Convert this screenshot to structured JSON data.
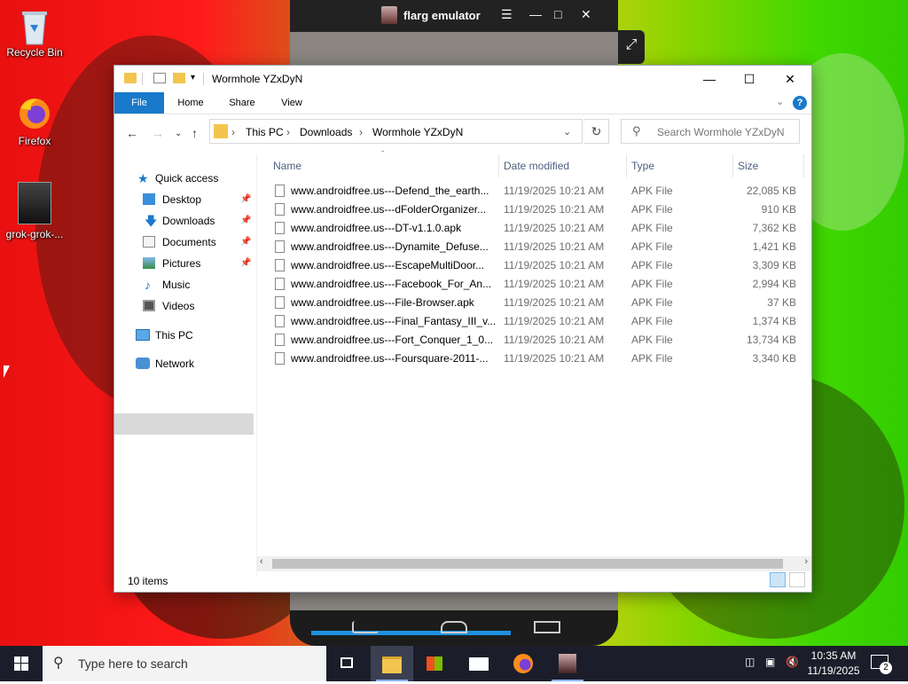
{
  "desktop": {
    "icons": [
      {
        "label": "Recycle Bin"
      },
      {
        "label": "Firefox"
      },
      {
        "label": "grok-grok-..."
      }
    ]
  },
  "emulator": {
    "title": "flarg emulator"
  },
  "explorer": {
    "title": "Wormhole YZxDyN",
    "ribbon_tabs": [
      "File",
      "Home",
      "Share",
      "View"
    ],
    "breadcrumb": [
      "This PC",
      "Downloads",
      "Wormhole YZxDyN"
    ],
    "search_placeholder": "Search Wormhole YZxDyN",
    "nav": {
      "quick_access": "Quick access",
      "desktop": "Desktop",
      "downloads": "Downloads",
      "documents": "Documents",
      "pictures": "Pictures",
      "music": "Music",
      "videos": "Videos",
      "this_pc": "This PC",
      "network": "Network"
    },
    "columns": {
      "name": "Name",
      "date": "Date modified",
      "type": "Type",
      "size": "Size"
    },
    "files": [
      {
        "name": "www.androidfree.us---Defend_the_earth...",
        "date": "11/19/2025 10:21 AM",
        "type": "APK File",
        "size": "22,085 KB"
      },
      {
        "name": "www.androidfree.us---dFolderOrganizer...",
        "date": "11/19/2025 10:21 AM",
        "type": "APK File",
        "size": "910 KB"
      },
      {
        "name": "www.androidfree.us---DT-v1.1.0.apk",
        "date": "11/19/2025 10:21 AM",
        "type": "APK File",
        "size": "7,362 KB"
      },
      {
        "name": "www.androidfree.us---Dynamite_Defuse...",
        "date": "11/19/2025 10:21 AM",
        "type": "APK File",
        "size": "1,421 KB"
      },
      {
        "name": "www.androidfree.us---EscapeMultiDoor...",
        "date": "11/19/2025 10:21 AM",
        "type": "APK File",
        "size": "3,309 KB"
      },
      {
        "name": "www.androidfree.us---Facebook_For_An...",
        "date": "11/19/2025 10:21 AM",
        "type": "APK File",
        "size": "2,994 KB"
      },
      {
        "name": "www.androidfree.us---File-Browser.apk",
        "date": "11/19/2025 10:21 AM",
        "type": "APK File",
        "size": "37 KB"
      },
      {
        "name": "www.androidfree.us---Final_Fantasy_III_v...",
        "date": "11/19/2025 10:21 AM",
        "type": "APK File",
        "size": "1,374 KB"
      },
      {
        "name": "www.androidfree.us---Fort_Conquer_1_0...",
        "date": "11/19/2025 10:21 AM",
        "type": "APK File",
        "size": "13,734 KB"
      },
      {
        "name": "www.androidfree.us---Foursquare-2011-...",
        "date": "11/19/2025 10:21 AM",
        "type": "APK File",
        "size": "3,340 KB"
      }
    ],
    "status": "10 items"
  },
  "taskbar": {
    "search_placeholder": "Type here to search",
    "time": "10:35 AM",
    "date": "11/19/2025",
    "notification_count": "2"
  },
  "colors": {
    "accent": "#1979ca",
    "taskbar": "#1b1e2a",
    "folder": "#f3c54f"
  }
}
